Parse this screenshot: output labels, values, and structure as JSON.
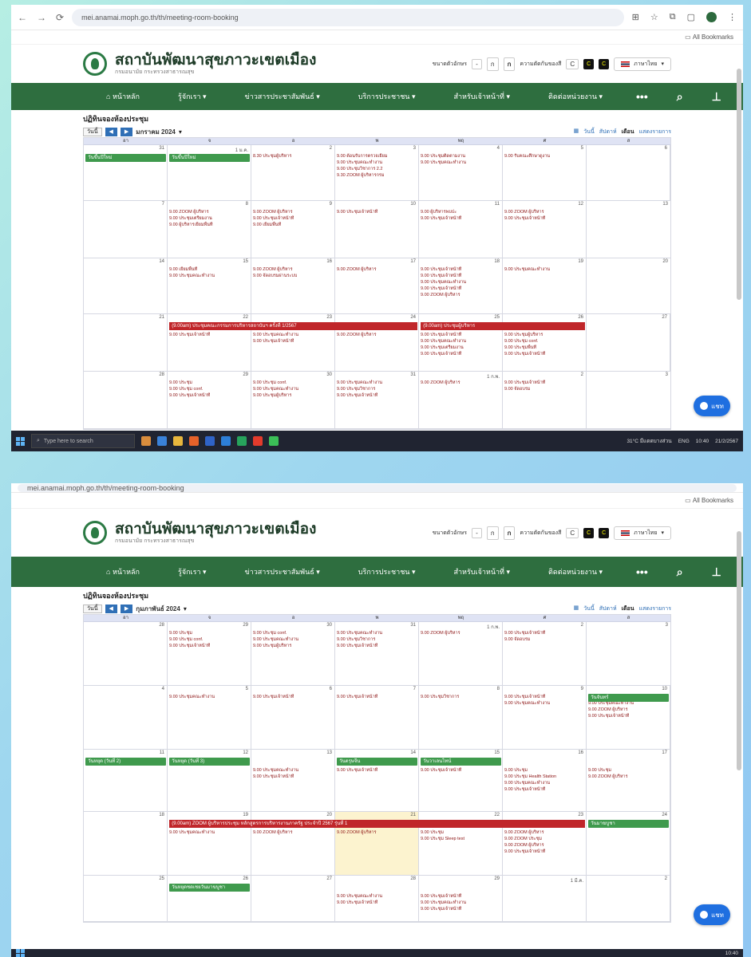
{
  "colors": {
    "nav_green": "#2e6e3f",
    "event_red": "#8b1111",
    "band_red": "#c0262a",
    "band_green": "#3f9a4d",
    "today": "#fcf3cf",
    "chat": "#1f6fe0"
  },
  "browser": {
    "url": "mei.anamai.moph.go.th/th/meeting-room-booking",
    "bookmarks": "All Bookmarks"
  },
  "site": {
    "title": "สถาบันพัฒนาสุขภาวะเขตเมือง",
    "subtitle": "กรมอนามัย กระทรวงสาธารณสุข",
    "font_label": "ขนาดตัวอักษร",
    "font_a1": "ก",
    "font_a2": "ก",
    "contrast_label": "ความตัดกันของสี",
    "contrast_c": "C",
    "lang": "ภาษาไทย"
  },
  "nav": {
    "home": "หน้าหลัก",
    "about": "รู้จักเรา",
    "news": "ข่าวสารประชาสัมพันธ์",
    "services": "บริการประชาชน",
    "regulations": "สำหรับเจ้าหน้าที่",
    "contact": "ติดต่อหน่วยงาน",
    "more": "•••"
  },
  "calendar": {
    "heading": "ปฏิทินจองห้องประชุม",
    "today_btn": "วันนี้",
    "view_month": "เดือน",
    "view_week": "สัปดาห์",
    "view_day": "วันนี้",
    "view_list": "แสดงรายการ",
    "dow": [
      "อา",
      "จ",
      "อ",
      "พ",
      "พฤ",
      "ศ",
      "ส"
    ]
  },
  "s1": {
    "month_label": "มกราคม 2024",
    "weeks": [
      {
        "dates": [
          "31",
          "1 ม.ค.",
          "2",
          "3",
          "4",
          "5",
          "6"
        ],
        "events": [
          [],
          [],
          [
            "8.30 ประชุมผู้บริหาร"
          ],
          [
            "9.00 ต้อนรับการตรวจเยี่ยม",
            "9.00 ประชุมคณะทำงาน",
            "9.00 ประชุมวิชาการ 2.2",
            "9.30 ZOOM ผู้บริหารกรม"
          ],
          [
            "9.00 ประชุมติดตามงาน",
            "9.00 ประชุมคณะทำงาน"
          ],
          [
            "9.00 รับคณะศึกษาดูงาน"
          ],
          []
        ]
      },
      {
        "dates": [
          "7",
          "8",
          "9",
          "10",
          "11",
          "12",
          "13"
        ],
        "events": [
          [],
          [
            "9.00 ZOOM ผู้บริหาร",
            "9.00 ประชุมเตรียมงาน",
            "9.00 ผู้บริหารเยี่ยมพื้นที่"
          ],
          [
            "9.00 ZOOM ผู้บริหาร",
            "9.00 ประชุมเจ้าหน้าที่",
            "9.00 เยี่ยมพื้นที่"
          ],
          [
            "9.00 ประชุมเจ้าหน้าที่"
          ],
          [
            "9.00 ผู้บริหารพบปะ",
            "9.00 ประชุมเจ้าหน้าที่"
          ],
          [
            "9.00 ZOOM ผู้บริหาร",
            "9.00 ประชุมเจ้าหน้าที่"
          ],
          []
        ]
      },
      {
        "dates": [
          "14",
          "15",
          "16",
          "17",
          "18",
          "19",
          "20"
        ],
        "events": [
          [],
          [
            "9.00 เยี่ยมพื้นที่",
            "9.00 ประชุมคณะทำงาน"
          ],
          [
            "9.00 ZOOM ผู้บริหาร",
            "9.00 จัดอบรมผ่านระบบ"
          ],
          [
            "9.00 ZOOM ผู้บริหาร"
          ],
          [
            "9.00 ประชุมเจ้าหน้าที่",
            "9.00 ประชุมเจ้าหน้าที่",
            "9.00 ประชุมคณะทำงาน",
            "9.00 ประชุมเจ้าหน้าที่",
            "9.00 ZOOM ผู้บริหาร"
          ],
          [
            "9.00 ประชุมคณะทำงาน"
          ],
          []
        ]
      },
      {
        "dates": [
          "21",
          "22",
          "23",
          "24",
          "25",
          "26",
          "27"
        ],
        "events": [
          [],
          [
            "9.00 ประชุมเจ้าหน้าที่"
          ],
          [
            "9.00 ประชุมคณะทำงาน",
            "9.00 ประชุมเจ้าหน้าที่"
          ],
          [
            "9.00 ZOOM ผู้บริหาร"
          ],
          [
            "9.00 ประชุมเจ้าหน้าที่",
            "9.00 ประชุมคณะทำงาน",
            "9.00 ประชุมเตรียมงาน",
            "9.00 ประชุมเจ้าหน้าที่"
          ],
          [
            "9.00 ประชุมผู้บริหาร",
            "9.00 ประชุม conf.",
            "9.00 ประชุมพื้นที่",
            "9.00 ประชุมเจ้าหน้าที่"
          ],
          []
        ]
      },
      {
        "dates": [
          "28",
          "29",
          "30",
          "31",
          "1 ก.พ.",
          "2",
          "3"
        ],
        "events": [
          [],
          [
            "9.00 ประชุม",
            "9.00 ประชุม conf.",
            "9.00 ประชุมเจ้าหน้าที่"
          ],
          [
            "9.00 ประชุม conf.",
            "9.00 ประชุมคณะทำงาน",
            "9.00 ประชุมผู้บริหาร"
          ],
          [
            "9.00 ประชุมคณะทำงาน",
            "9.00 ประชุมวิชาการ",
            "9.00 ประชุมเจ้าหน้าที่"
          ],
          [
            "9.00 ZOOM ผู้บริหาร"
          ],
          [
            "9.00 ประชุมเจ้าหน้าที่",
            "9.00 จัดอบรม"
          ],
          []
        ]
      }
    ],
    "bands": {
      "w1_a": "วันขึ้นปีใหม่",
      "w1_b": "วันขึ้นปีใหม่",
      "w4_a": "(9.00am) ประชุมคณะกรรมการบริหารสถาบันฯ ครั้งที่ 1/2567",
      "w4_b": "(9.00am) ประชุมผู้บริหาร"
    }
  },
  "s2": {
    "month_label": "กุมภาพันธ์ 2024",
    "weeks": [
      {
        "dates": [
          "28",
          "29",
          "30",
          "31",
          "1 ก.พ.",
          "2",
          "3"
        ],
        "events": [
          [],
          [
            "9.00 ประชุม",
            "9.00 ประชุม conf.",
            "9.00 ประชุมเจ้าหน้าที่"
          ],
          [
            "9.00 ประชุม conf.",
            "9.00 ประชุมคณะทำงาน",
            "9.00 ประชุมผู้บริหาร"
          ],
          [
            "9.00 ประชุมคณะทำงาน",
            "9.00 ประชุมวิชาการ",
            "9.00 ประชุมเจ้าหน้าที่"
          ],
          [
            "9.00 ZOOM ผู้บริหาร"
          ],
          [
            "9.00 ประชุมเจ้าหน้าที่",
            "9.00 จัดอบรม"
          ],
          []
        ]
      },
      {
        "dates": [
          "4",
          "5",
          "6",
          "7",
          "8",
          "9",
          "10"
        ],
        "events": [
          [],
          [
            "9.00 ประชุมคณะทำงาน"
          ],
          [
            "9.00 ประชุมเจ้าหน้าที่"
          ],
          [
            "9.00 ประชุมเจ้าหน้าที่"
          ],
          [
            "9.00 ประชุมวิชาการ"
          ],
          [
            "9.00 ประชุมเจ้าหน้าที่",
            "9.00 ประชุมคณะทำงาน"
          ],
          [
            "9.00 ZOOM ผู้บริหาร",
            "9.00 ประชุมคณะทำงาน",
            "9.00 ZOOM ผู้บริหาร",
            "9.00 ประชุมเจ้าหน้าที่"
          ]
        ]
      },
      {
        "dates": [
          "11",
          "12",
          "13",
          "14",
          "15",
          "16",
          "17"
        ],
        "events": [
          [],
          [],
          [
            "9.00 ประชุมคณะทำงาน",
            "9.00 ประชุมเจ้าหน้าที่"
          ],
          [
            "9.00 ประชุมเจ้าหน้าที่"
          ],
          [
            "9.00 ประชุมเจ้าหน้าที่"
          ],
          [
            "9.00 ประชุม",
            "9.00 ประชุม Health Station",
            "9.00 ประชุมคณะทำงาน",
            "9.00 ประชุมเจ้าหน้าที่"
          ],
          [
            "9.00 ประชุม",
            "9.00 ZOOM ผู้บริหาร"
          ]
        ]
      },
      {
        "dates": [
          "18",
          "19",
          "20",
          "21",
          "22",
          "23",
          "24"
        ],
        "events": [
          [],
          [
            "9.00 ประชุมคณะทำงาน"
          ],
          [
            "9.00 ZOOM ผู้บริหาร"
          ],
          [
            "9.00 ZOOM ผู้บริหาร"
          ],
          [
            "9.00 ประชุม",
            "9.00 ประชุม Sleep test"
          ],
          [
            "9.00 ZOOM ผู้บริหาร",
            "9.00 ZOOM ประชุม",
            "9.00 ZOOM ผู้บริหาร",
            "9.00 ประชุมเจ้าหน้าที่"
          ],
          []
        ]
      },
      {
        "dates": [
          "25",
          "26",
          "27",
          "28",
          "29",
          "1 มี.ค.",
          "2"
        ],
        "events": [
          [],
          [],
          [],
          [
            "9.00 ประชุมคณะทำงาน",
            "9.00 ประชุมเจ้าหน้าที่"
          ],
          [
            "9.00 ประชุมเจ้าหน้าที่",
            "9.00 ประชุมคณะทำงาน",
            "9.00 ประชุมเจ้าหน้าที่"
          ],
          [],
          []
        ]
      }
    ],
    "bands": {
      "w2_sat": "วันจันทร์",
      "w3_a": "วันหยุด (วันที่ 2)",
      "w3_b": "วันหยุด (วันที่ 3)",
      "w3_c": "วันตรุษจีน",
      "w3_d": "วันวาเลนไทน์",
      "w4_red": "(9.00am) ZOOM ผู้บริหารประชุม หลักสูตรการบริหารงานภาครัฐ ประจำปี 2567 รุ่นที่ 1",
      "w4_green": "วันมาฆบูชา",
      "w5_green": "วันหยุดชดเชยวันมาฆบูชา"
    }
  },
  "chat": {
    "label": "แชท"
  },
  "taskbar": {
    "search": "Type here to search",
    "weather": "31°C มีแดดบางส่วน",
    "lang": "ENG",
    "time1": "10:40",
    "date1": "21/2/2567",
    "time2": "10:40"
  }
}
